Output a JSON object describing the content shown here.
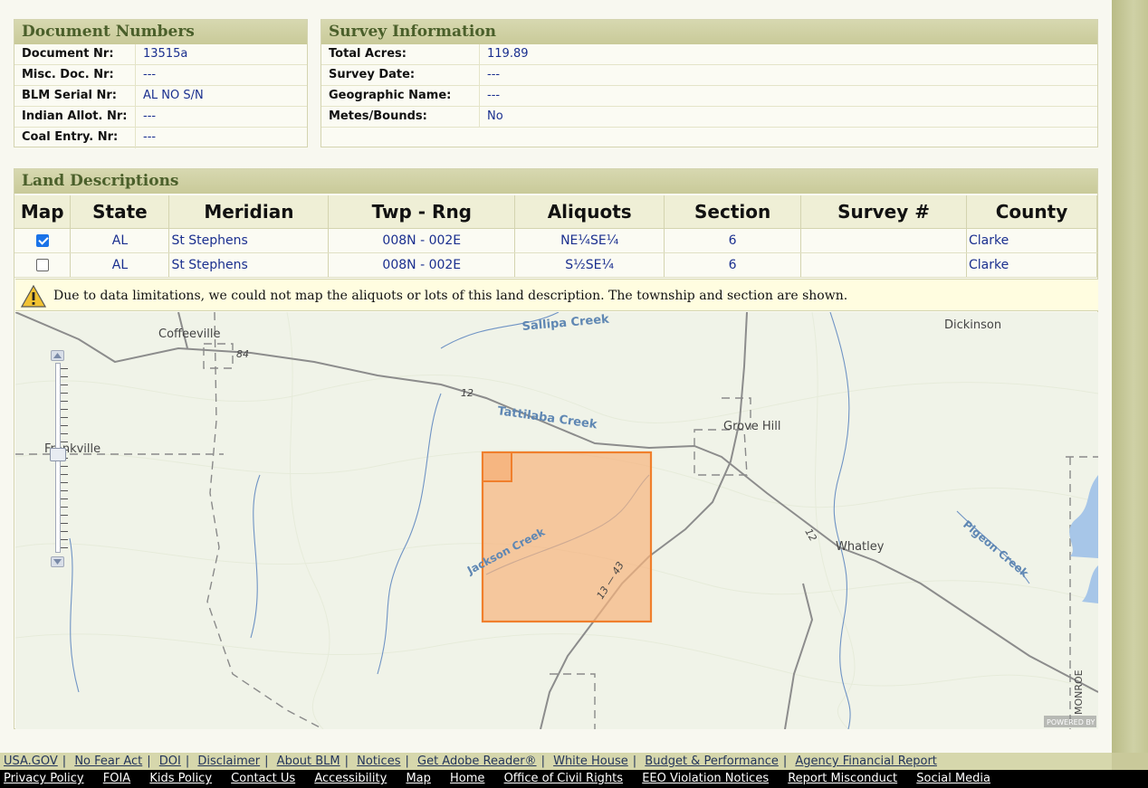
{
  "document_numbers": {
    "title": "Document Numbers",
    "rows": [
      {
        "label": "Document Nr:",
        "value": "13515a"
      },
      {
        "label": "Misc. Doc. Nr:",
        "value": "---"
      },
      {
        "label": "BLM Serial Nr:",
        "value": "AL NO S/N"
      },
      {
        "label": "Indian Allot. Nr:",
        "value": "---"
      },
      {
        "label": "Coal Entry. Nr:",
        "value": "---"
      }
    ]
  },
  "survey_information": {
    "title": "Survey Information",
    "rows": [
      {
        "label": "Total Acres:",
        "value": "119.89"
      },
      {
        "label": "Survey Date:",
        "value": "---"
      },
      {
        "label": "Geographic Name:",
        "value": "---"
      },
      {
        "label": "Metes/Bounds:",
        "value": "No"
      }
    ]
  },
  "land_descriptions": {
    "title": "Land Descriptions",
    "columns": [
      "Map",
      "State",
      "Meridian",
      "Twp - Rng",
      "Aliquots",
      "Section",
      "Survey #",
      "County"
    ],
    "rows": [
      {
        "checked": true,
        "state": "AL",
        "meridian": "St Stephens",
        "twp_rng": "008N - 002E",
        "aliquots": "NE¼SE¼",
        "section": "6",
        "survey": "",
        "county": "Clarke"
      },
      {
        "checked": false,
        "state": "AL",
        "meridian": "St Stephens",
        "twp_rng": "008N - 002E",
        "aliquots": "S½SE¼",
        "section": "6",
        "survey": "",
        "county": "Clarke"
      }
    ],
    "warning": "Due to data limitations, we could not map the aliquots or lots of this land description. The township and section are shown."
  },
  "map": {
    "labels": {
      "coffeeville": "Coffeeville",
      "dickinson": "Dickinson",
      "frankville": "Frankville",
      "grove_hill": "Grove Hill",
      "whatley": "Whatley",
      "sallipa_creek": "Sallipa Creek",
      "tattilaba_creek": "Tattilaba Creek",
      "jackson_creek": "Jackson Creek",
      "pigeon_creek": "Pigeon Creek",
      "route_84": "84",
      "route_12a": "12",
      "route_12b": "12",
      "route_13_43": "13 — 43",
      "monroe": "MONROE",
      "powered_by": "POWERED BY"
    },
    "colors": {
      "parcel_fill": "#f6b47e",
      "parcel_stroke": "#f07f2c"
    },
    "zoom_level": 0.42
  },
  "footer": {
    "links_top": [
      "USA.GOV",
      "No Fear Act",
      "DOI",
      "Disclaimer",
      "About BLM",
      "Notices",
      "Get Adobe Reader®",
      "White House",
      "Budget & Performance",
      "Agency Financial Report"
    ],
    "links_bottom": [
      "Privacy Policy",
      "FOIA",
      "Kids Policy",
      "Contact Us",
      "Accessibility",
      "Map",
      "Home",
      "Office of Civil Rights",
      "EEO Violation Notices",
      "Report Misconduct",
      "Social Media"
    ]
  }
}
